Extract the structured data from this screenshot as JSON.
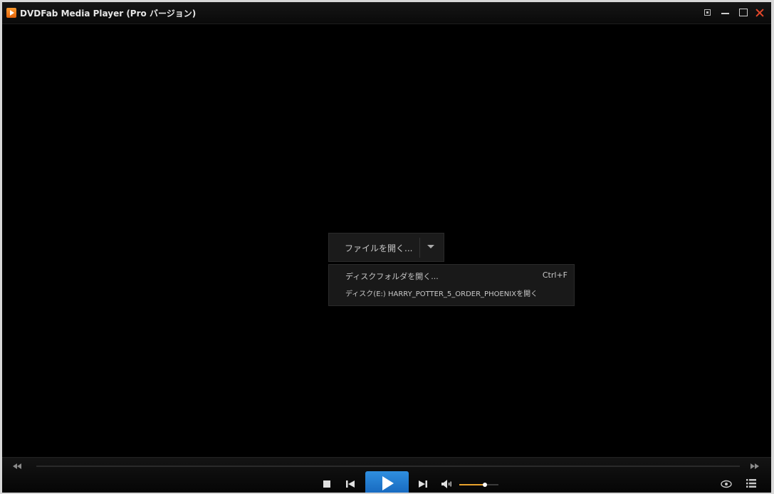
{
  "window": {
    "title": "DVDFab Media Player (Pro バージョン)"
  },
  "open_menu": {
    "button_label": "ファイルを開く...",
    "items": [
      {
        "label": "ディスクフォルダを開く...",
        "shortcut": "Ctrl+F"
      },
      {
        "label": "ディスク(E:) HARRY_POTTER_5_ORDER_PHOENIXを開く",
        "shortcut": ""
      }
    ]
  },
  "controls": {
    "volume_level": 0.65
  },
  "colors": {
    "accent_play": "#2f8fe0",
    "volume_fill": "#e8a22c",
    "close_x": "#e4472a",
    "app_icon": "#f07f1c"
  },
  "icons": {
    "app": "app-logo-icon",
    "compact": "compact-mode-icon",
    "minimize": "minimize-icon",
    "maximize": "maximize-icon",
    "close": "close-icon",
    "dropdown": "chevron-down-icon",
    "seek_back": "rewind-icon",
    "seek_forward": "fast-forward-icon",
    "stop": "stop-icon",
    "previous": "skip-previous-icon",
    "play": "play-icon",
    "next": "skip-next-icon",
    "volume": "volume-icon",
    "view": "eye-icon",
    "playlist": "playlist-icon"
  }
}
